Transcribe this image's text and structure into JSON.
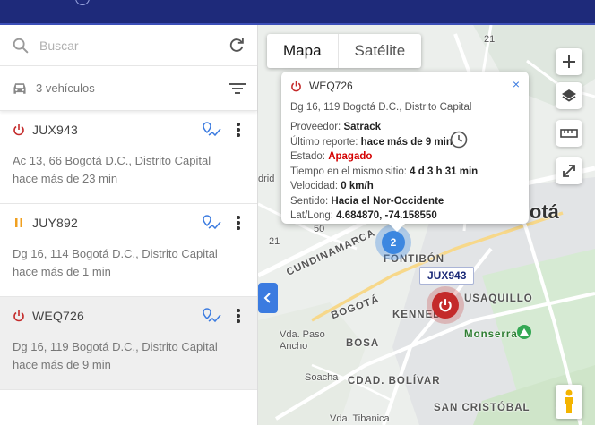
{
  "search": {
    "placeholder": "Buscar"
  },
  "vehicles_bar": {
    "count_text": "3 vehículos"
  },
  "vehicles": [
    {
      "plate": "JUX943",
      "status": "off",
      "address": "Ac 13, 66 Bogotá D.C., Distrito Capital",
      "time": "hace más de 23 min"
    },
    {
      "plate": "JUY892",
      "status": "paused",
      "address": "Dg 16, 114 Bogotá D.C., Distrito Capital",
      "time": "hace más de 1 min"
    },
    {
      "plate": "WEQ726",
      "status": "off",
      "address": "Dg 16, 119 Bogotá D.C., Distrito Capital",
      "time": "hace más de 9 min"
    }
  ],
  "map": {
    "type_buttons": {
      "map": "Mapa",
      "satellite": "Satélite"
    },
    "labels": {
      "fontibon": "FONTIBÓN",
      "cundinamarca": "CUNDINAMARCA",
      "bogota_road": "BOGOTÁ",
      "kennedy": "KENNEDY",
      "bosa": "BOSA",
      "usaquillo": "USAQUILLO",
      "ciudad_bolivar": "CDAD. BOLÍVAR",
      "san_cristobal": "SAN CRISTÓBAL",
      "monserrate": "Monserrate",
      "vda_pasoancho": "Vda. Paso\nAncho",
      "soacha": "Soacha",
      "vda_tibanica": "Vda. Tibanica",
      "city": "ogotá",
      "drid": "drid",
      "r21a": "21",
      "r21b": "21",
      "r50": "50",
      "r21c": "21"
    },
    "cluster_count": "2",
    "marker_tag": "JUX943"
  },
  "popup": {
    "plate": "WEQ726",
    "address": "Dg 16, 119 Bogotá D.C., Distrito Capital",
    "provider_label": "Proveedor:",
    "provider": "Satrack",
    "last_report_label": "Último reporte:",
    "last_report": "hace más de 9 min",
    "state_label": "Estado:",
    "state": "Apagado",
    "same_place_label": "Tiempo en el mismo sitio:",
    "same_place": "4 d 3 h 31 min",
    "speed_label": "Velocidad:",
    "speed": "0 km/h",
    "direction_label": "Sentido:",
    "direction": "Hacia el Nor-Occidente",
    "latlong_label": "Lat/Long:",
    "latlong": "4.684870, -74.158550",
    "close": "×"
  },
  "colors": {
    "topbar": "#1e2a7a",
    "accent": "#3b7be0",
    "off": "#c42a2a",
    "paused": "#f0a020"
  }
}
